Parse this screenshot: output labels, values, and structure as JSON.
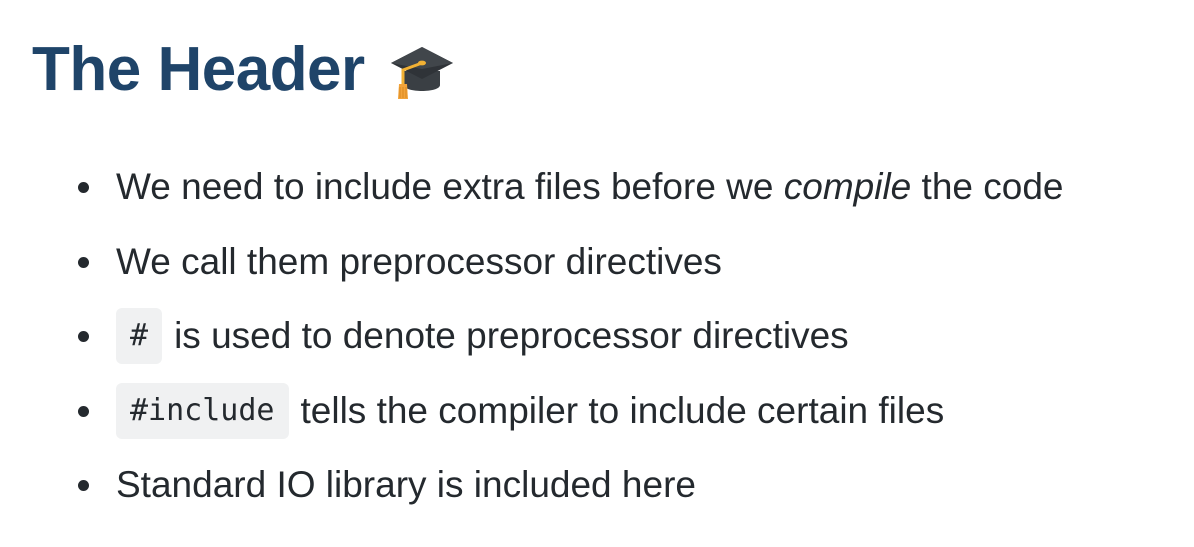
{
  "header": {
    "title": "The Header",
    "icon": "graduation-cap-icon"
  },
  "bullets": [
    {
      "before": "We need to include extra files before we ",
      "emphasis": "compile",
      "after": " the code"
    },
    {
      "text": "We call them preprocessor directives"
    },
    {
      "code": "#",
      "text": "is used to denote preprocessor directives"
    },
    {
      "code": "#include",
      "text": "tells the compiler to include certain files"
    },
    {
      "text": "Standard IO library is included here"
    }
  ],
  "colors": {
    "title": "#1f4469",
    "body_text": "#24292e",
    "code_background": "#f0f1f2"
  }
}
